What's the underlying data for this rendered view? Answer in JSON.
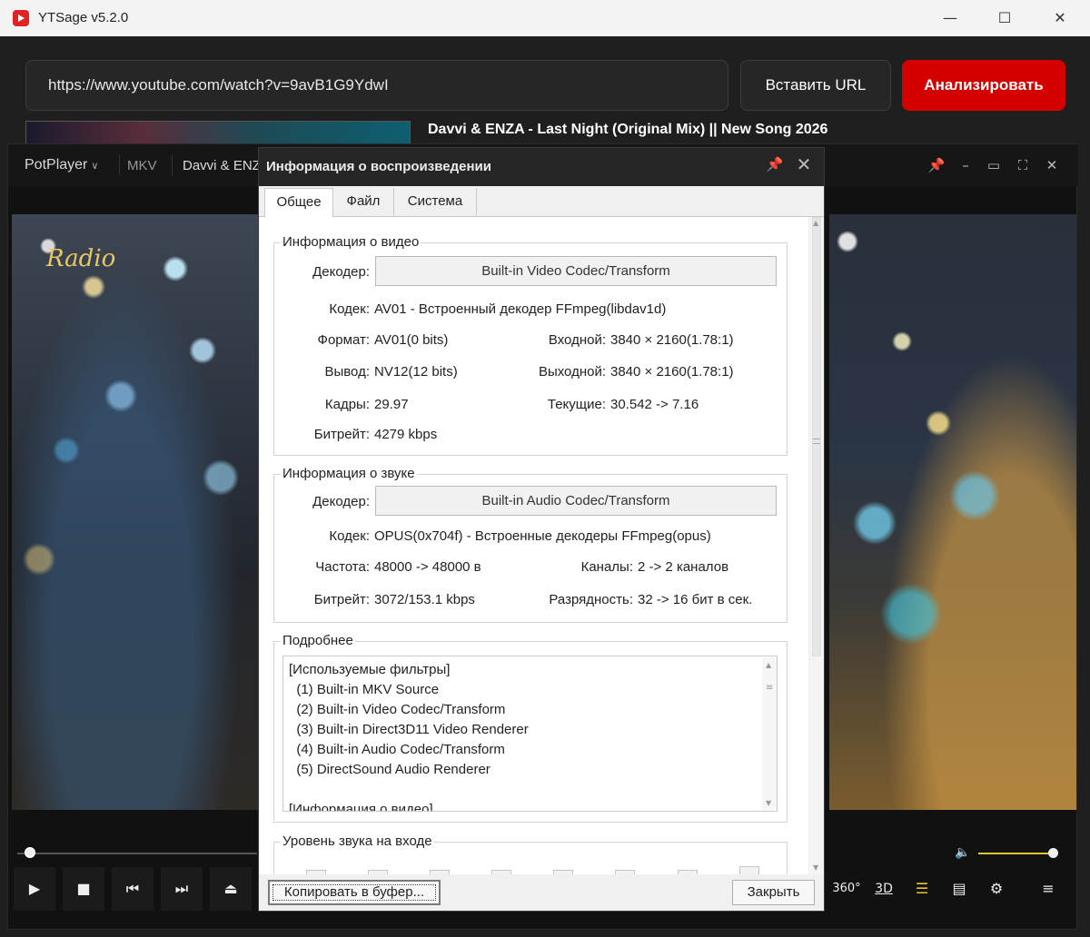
{
  "ytsage": {
    "app_title": "YTSage  v5.2.0",
    "url_value": "https://www.youtube.com/watch?v=9avB1G9YdwI",
    "paste_label": "Вставить URL",
    "analyze_label": "Анализировать",
    "video_title": "Davvi & ENZA - Last Night (Original Mix) || New Song 2026",
    "accent_color": "#d40000",
    "window_controls": {
      "minimize": "—",
      "maximize": "☐",
      "close": "✕"
    }
  },
  "potplayer": {
    "app_name": "PotPlayer",
    "format": "MKV",
    "file_name": "Davvi & ENZA - Last Night",
    "watermark": "Radio",
    "playback_position": 0.02,
    "volume_level": 1.0,
    "title_icons": [
      "pin-icon",
      "minimize-icon",
      "maximize-icon",
      "fullscreen-icon",
      "close-icon"
    ],
    "controls": [
      "play-icon",
      "stop-icon",
      "previous-icon",
      "next-icon",
      "eject-icon"
    ],
    "right_controls": {
      "vr": "360°",
      "three_d": "3D"
    },
    "accent_color": "#e8c430"
  },
  "dialog": {
    "title": "Информация о воспроизведении",
    "tabs": [
      "Общее",
      "Файл",
      "Система"
    ],
    "video": {
      "heading": "Информация о видео",
      "decoder_label": "Декодер:",
      "decoder_value": "Built-in Video Codec/Transform",
      "codec_label": "Кодек:",
      "codec_value": "AV01 - Встроенный декодер FFmpeg(libdav1d)",
      "format_label": "Формат:",
      "format_value": "AV01(0 bits)",
      "input_label": "Входной:",
      "input_value": "3840 × 2160(1.78:1)",
      "output_label": "Вывод:",
      "output_value": "NV12(12 bits)",
      "outsize_label": "Выходной:",
      "outsize_value": "3840 × 2160(1.78:1)",
      "frames_label": "Кадры:",
      "frames_value": "29.97",
      "current_label": "Текущие:",
      "current_value": "30.542 -> 7.16",
      "bitrate_label": "Битрейт:",
      "bitrate_value": "4279 kbps"
    },
    "audio": {
      "heading": "Информация о звуке",
      "decoder_label": "Декодер:",
      "decoder_value": "Built-in Audio Codec/Transform",
      "codec_label": "Кодек:",
      "codec_value": "OPUS(0x704f) - Встроенные декодеры FFmpeg(opus)",
      "freq_label": "Частота:",
      "freq_value": "48000 -> 48000 в",
      "channels_label": "Каналы:",
      "channels_value": "2 -> 2 каналов",
      "bitrate_label": "Битрейт:",
      "bitrate_value": "3072/153.1 kbps",
      "depth_label": "Разрядность:",
      "depth_value": "32 -> 16 бит в сек."
    },
    "details": {
      "heading": "Подробнее",
      "lines": [
        "[Используемые фильтры]",
        "  (1) Built-in MKV Source",
        "  (2) Built-in Video Codec/Transform",
        "  (3) Built-in Direct3D11 Video Renderer",
        "  (4) Built-in Audio Codec/Transform",
        "  (5) DirectSound Audio Renderer",
        "",
        "[Информация о видео]"
      ]
    },
    "input_level": {
      "heading": "Уровень звука на входе"
    },
    "copy_label": "Копировать в буфер...",
    "close_label": "Закрыть"
  }
}
